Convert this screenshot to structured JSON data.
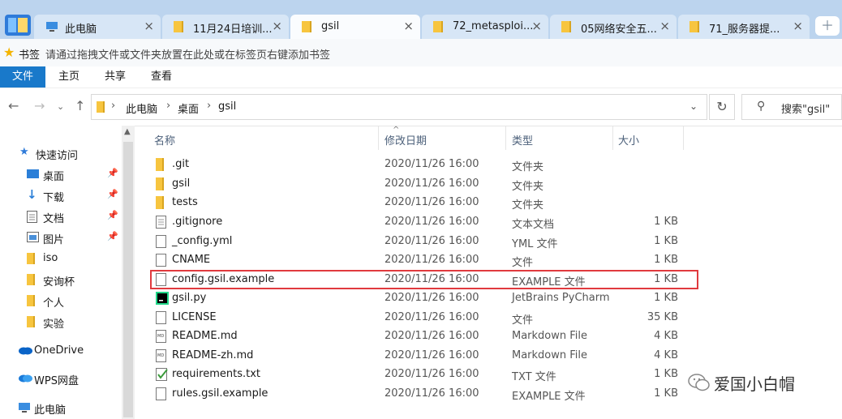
{
  "tabs": [
    {
      "title": "此电脑",
      "icon": "computer-icon",
      "active": false
    },
    {
      "title": "11月24日培训...",
      "icon": "folder-icon",
      "active": false
    },
    {
      "title": "gsil",
      "icon": "folder-icon",
      "active": true
    },
    {
      "title": "72_metasploi...",
      "icon": "folder-icon",
      "active": false
    },
    {
      "title": "05网络安全五...",
      "icon": "folder-icon",
      "active": false
    },
    {
      "title": "71_服务器提...",
      "icon": "folder-icon",
      "active": false
    }
  ],
  "bookmarks": {
    "label": "书签",
    "hint": "请通过拖拽文件或文件夹放置在此处或在标签页右键添加书签"
  },
  "ribbon": {
    "tabs": [
      "文件",
      "主页",
      "共享",
      "查看"
    ]
  },
  "address": {
    "crumbs": [
      "此电脑",
      "桌面",
      "gsil"
    ],
    "search_placeholder": "搜索\"gsil\""
  },
  "sidebar": {
    "quick_access": "快速访问",
    "pinned": [
      {
        "label": "桌面",
        "icon": "desktop-icon",
        "pinned": true
      },
      {
        "label": "下载",
        "icon": "download-icon",
        "pinned": true
      },
      {
        "label": "文档",
        "icon": "document-icon",
        "pinned": true
      },
      {
        "label": "图片",
        "icon": "picture-icon",
        "pinned": true
      },
      {
        "label": "iso",
        "icon": "folder-icon",
        "pinned": false
      },
      {
        "label": "安询杯",
        "icon": "folder-icon",
        "pinned": false
      },
      {
        "label": "个人",
        "icon": "folder-icon",
        "pinned": false
      },
      {
        "label": "实验",
        "icon": "folder-icon",
        "pinned": false
      }
    ],
    "onedrive": "OneDrive",
    "wps": "WPS网盘",
    "this_pc": "此电脑"
  },
  "columns": {
    "name": "名称",
    "date": "修改日期",
    "type": "类型",
    "size": "大小"
  },
  "files": [
    {
      "name": ".git",
      "date": "2020/11/26 16:00",
      "type": "文件夹",
      "size": "",
      "icon": "folder-icon"
    },
    {
      "name": "gsil",
      "date": "2020/11/26 16:00",
      "type": "文件夹",
      "size": "",
      "icon": "folder-icon"
    },
    {
      "name": "tests",
      "date": "2020/11/26 16:00",
      "type": "文件夹",
      "size": "",
      "icon": "folder-icon"
    },
    {
      "name": ".gitignore",
      "date": "2020/11/26 16:00",
      "type": "文本文档",
      "size": "1 KB",
      "icon": "text-file-icon"
    },
    {
      "name": "_config.yml",
      "date": "2020/11/26 16:00",
      "type": "YML 文件",
      "size": "1 KB",
      "icon": "file-icon"
    },
    {
      "name": "CNAME",
      "date": "2020/11/26 16:00",
      "type": "文件",
      "size": "1 KB",
      "icon": "file-icon"
    },
    {
      "name": "config.gsil.example",
      "date": "2020/11/26 16:00",
      "type": "EXAMPLE 文件",
      "size": "1 KB",
      "icon": "file-icon"
    },
    {
      "name": "gsil.py",
      "date": "2020/11/26 16:00",
      "type": "JetBrains PyCharm",
      "size": "1 KB",
      "icon": "pycharm-icon"
    },
    {
      "name": "LICENSE",
      "date": "2020/11/26 16:00",
      "type": "文件",
      "size": "35 KB",
      "icon": "file-icon"
    },
    {
      "name": "README.md",
      "date": "2020/11/26 16:00",
      "type": "Markdown File",
      "size": "4 KB",
      "icon": "markdown-icon"
    },
    {
      "name": "README-zh.md",
      "date": "2020/11/26 16:00",
      "type": "Markdown File",
      "size": "4 KB",
      "icon": "markdown-icon"
    },
    {
      "name": "requirements.txt",
      "date": "2020/11/26 16:00",
      "type": "TXT 文件",
      "size": "1 KB",
      "icon": "txt-file-icon"
    },
    {
      "name": "rules.gsil.example",
      "date": "2020/11/26 16:00",
      "type": "EXAMPLE 文件",
      "size": "1 KB",
      "icon": "file-icon"
    }
  ],
  "watermark": "爱国小白帽",
  "colors": {
    "accent": "#1979ca",
    "highlight": "#e03a3e",
    "folder": "#f7c53f"
  }
}
